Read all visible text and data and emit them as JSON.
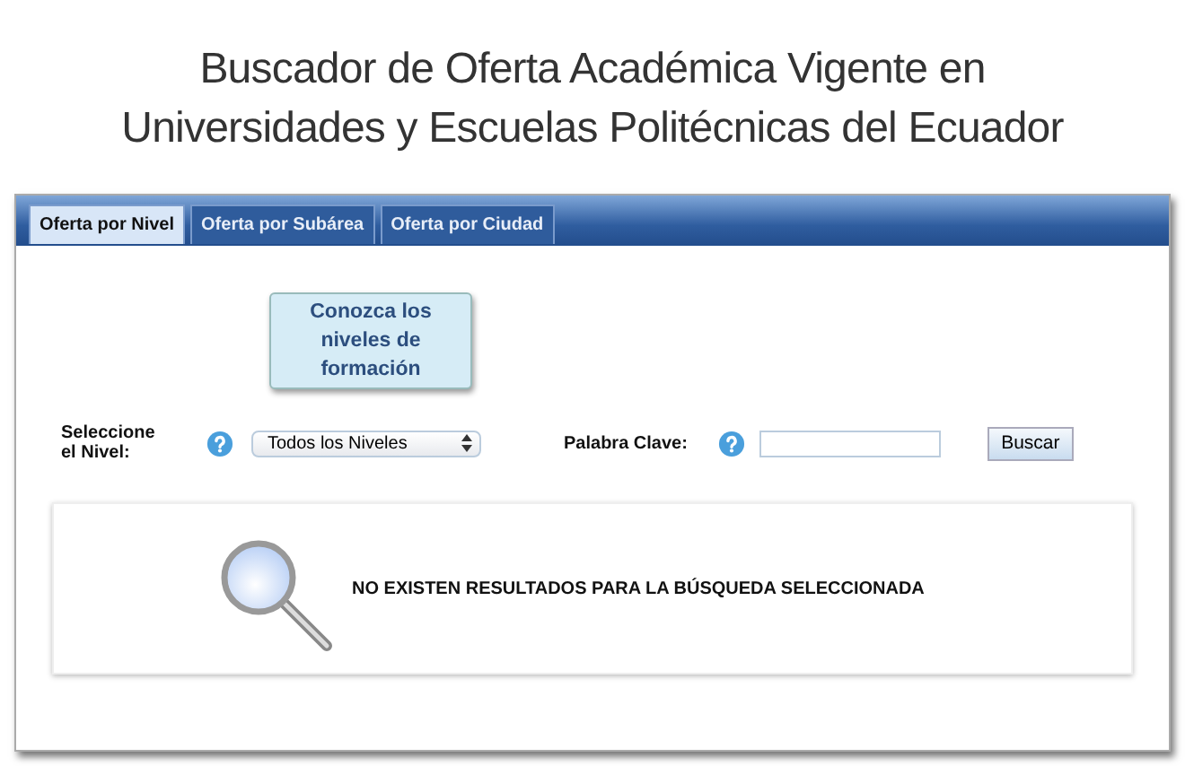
{
  "title_lines": [
    "Buscador de Oferta Académica Vigente en",
    "Universidades y Escuelas Politécnicas del Ecuador"
  ],
  "tabs": [
    {
      "label": "Oferta por Nivel",
      "selected": true
    },
    {
      "label": "Oferta por Subárea",
      "selected": false
    },
    {
      "label": "Oferta por Ciudad",
      "selected": false
    }
  ],
  "levels_button": "Conozca los niveles de formación",
  "level_label": "Seleccione el Nivel:",
  "level_select": {
    "value": "Todos los Niveles"
  },
  "keyword_label": "Palabra Clave:",
  "search_button": "Buscar",
  "results_message": "NO EXISTEN RESULTADOS PARA LA BÚSQUEDA SELECCIONADA"
}
